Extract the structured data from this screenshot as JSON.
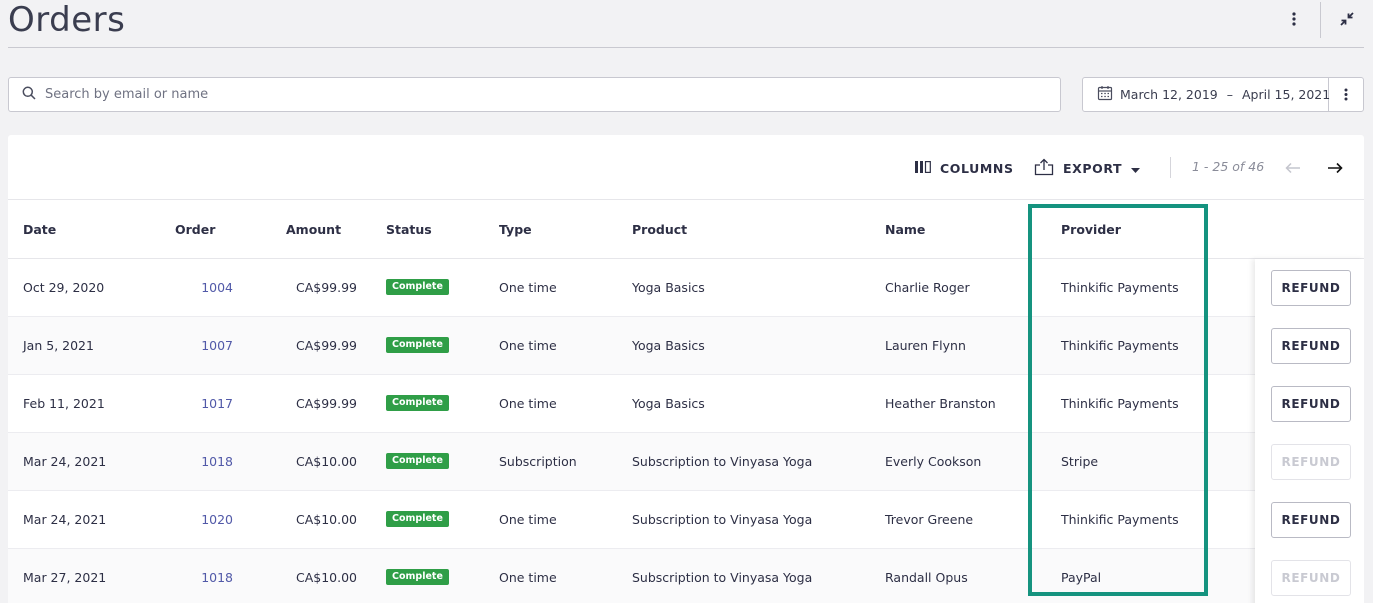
{
  "header": {
    "title": "Orders"
  },
  "search": {
    "placeholder": "Search by email or name"
  },
  "date_range": {
    "start": "March 12, 2019",
    "separator": "–",
    "end": "April 15, 2021"
  },
  "toolbar": {
    "columns_label": "COLUMNS",
    "export_label": "EXPORT",
    "pagination": "1 - 25 of 46"
  },
  "table": {
    "headers": {
      "date": "Date",
      "order": "Order",
      "amount": "Amount",
      "status": "Status",
      "type": "Type",
      "product": "Product",
      "name": "Name",
      "provider": "Provider"
    },
    "rows": [
      {
        "date": "Oct 29, 2020",
        "order": "1004",
        "amount": "CA$99.99",
        "status": "Complete",
        "type": "One time",
        "product": "Yoga Basics",
        "name": "Charlie Roger",
        "provider": "Thinkific Payments",
        "action": "REFUND",
        "action_enabled": true
      },
      {
        "date": "Jan 5, 2021",
        "order": "1007",
        "amount": "CA$99.99",
        "status": "Complete",
        "type": "One time",
        "product": "Yoga Basics",
        "name": "Lauren Flynn",
        "provider": "Thinkific Payments",
        "action": "REFUND",
        "action_enabled": true
      },
      {
        "date": "Feb 11, 2021",
        "order": "1017",
        "amount": "CA$99.99",
        "status": "Complete",
        "type": "One time",
        "product": "Yoga Basics",
        "name": "Heather Branston",
        "provider": "Thinkific Payments",
        "action": "REFUND",
        "action_enabled": true
      },
      {
        "date": "Mar 24, 2021",
        "order": "1018",
        "amount": "CA$10.00",
        "status": "Complete",
        "type": "Subscription",
        "product": "Subscription to Vinyasa Yoga",
        "name": "Everly Cookson",
        "provider": "Stripe",
        "action": "REFUND",
        "action_enabled": false
      },
      {
        "date": "Mar 24, 2021",
        "order": "1020",
        "amount": "CA$10.00",
        "status": "Complete",
        "type": "One time",
        "product": "Subscription to Vinyasa Yoga",
        "name": "Trevor Greene",
        "provider": "Thinkific Payments",
        "action": "REFUND",
        "action_enabled": true
      },
      {
        "date": "Mar 27, 2021",
        "order": "1018",
        "amount": "CA$10.00",
        "status": "Complete",
        "type": "One time",
        "product": "Subscription to Vinyasa Yoga",
        "name": "Randall Opus",
        "provider": "PayPal",
        "action": "REFUND",
        "action_enabled": false
      }
    ]
  },
  "colors": {
    "status_complete": "#2f9e47",
    "order_link": "#5159a8",
    "highlight": "#15937f"
  },
  "icons": {
    "search": "search-icon",
    "calendar": "calendar-icon",
    "columns": "columns-icon",
    "export": "export-icon"
  }
}
